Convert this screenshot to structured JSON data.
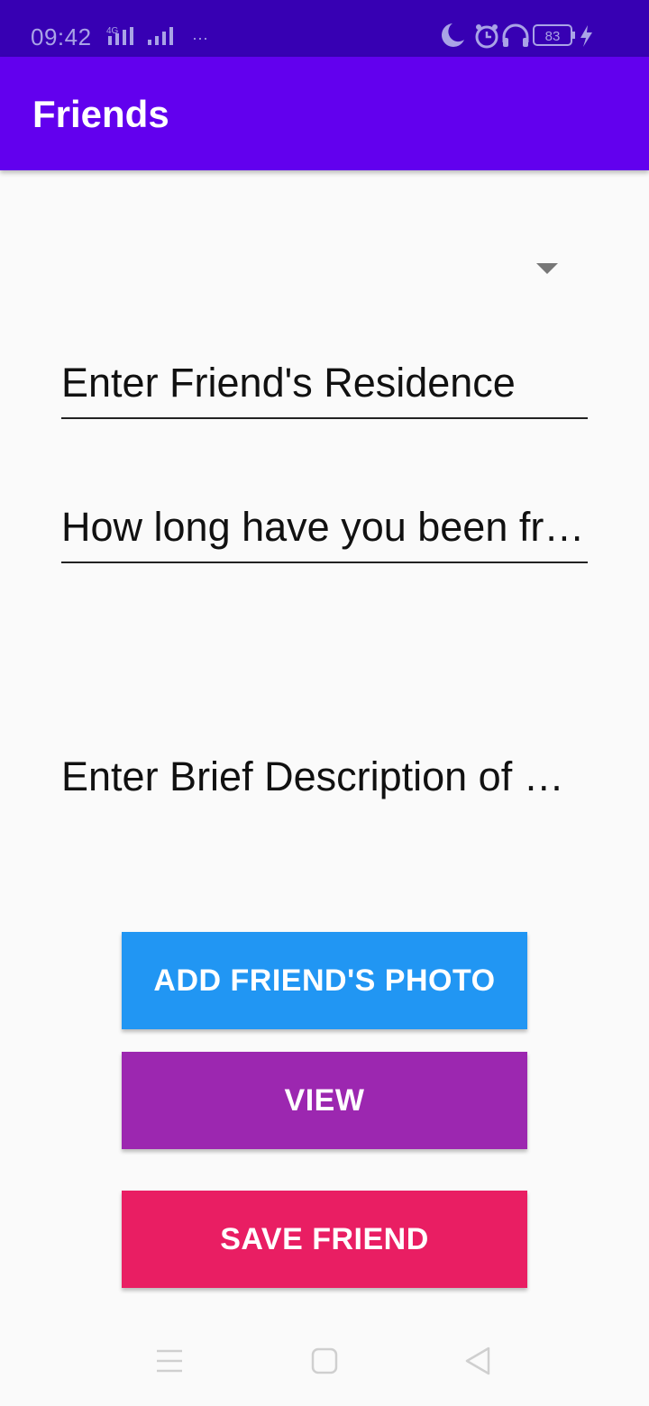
{
  "status_bar": {
    "time": "09:42",
    "network_label": "4G",
    "more": "···",
    "battery": "83"
  },
  "app_bar": {
    "title": "Friends"
  },
  "form": {
    "spinner_value": "",
    "residence_placeholder": "Enter Friend's Residence",
    "duration_placeholder": "How long have you been friends?",
    "description_placeholder": "Enter Brief Description of Friend"
  },
  "buttons": {
    "add_photo": "ADD FRIEND'S PHOTO",
    "view": "VIEW",
    "save": "SAVE FRIEND"
  },
  "colors": {
    "status_bar": "#3700b3",
    "app_bar": "#6200ee",
    "add_photo": "#2196f3",
    "view": "#9c27b0",
    "save": "#e91e63"
  },
  "nav_bar": {
    "icons": [
      "menu-icon",
      "home-icon",
      "back-icon"
    ]
  }
}
